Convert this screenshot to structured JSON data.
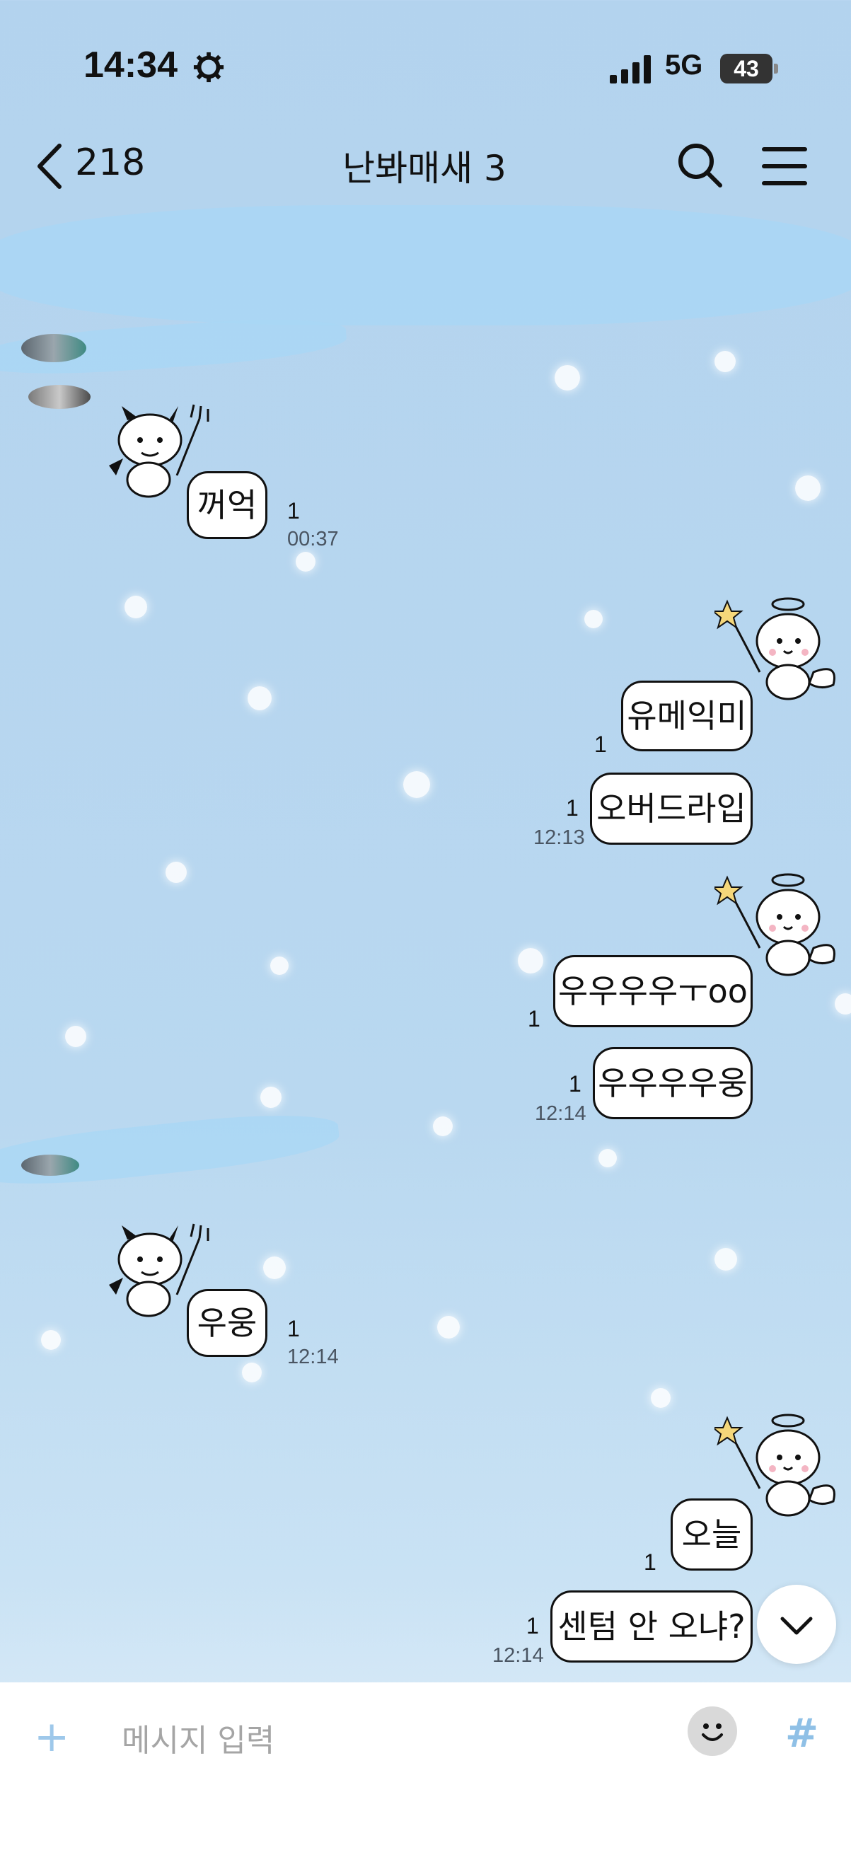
{
  "status_bar": {
    "time": "14:34",
    "network": "5G",
    "battery": "43"
  },
  "header": {
    "back_count": "218",
    "title": "난봐매새 3"
  },
  "messages": [
    {
      "side": "left",
      "text": "꺼억",
      "unread": "1",
      "time": "00:37"
    },
    {
      "side": "right",
      "text": "유메익미",
      "unread": "1",
      "time": ""
    },
    {
      "side": "right",
      "text": "오버드라입",
      "unread": "1",
      "time": "12:13"
    },
    {
      "side": "right",
      "text": "우우우우ㅜoo",
      "unread": "1",
      "time": ""
    },
    {
      "side": "right",
      "text": "우우우우웅",
      "unread": "1",
      "time": "12:14"
    },
    {
      "side": "left",
      "text": "우웅",
      "unread": "1",
      "time": "12:14"
    },
    {
      "side": "right",
      "text": "오늘",
      "unread": "1",
      "time": ""
    },
    {
      "side": "right",
      "text": "센텀 안 오냐?",
      "unread": "1",
      "time": "12:14"
    }
  ],
  "input": {
    "placeholder": "메시지 입력"
  },
  "icons": {
    "back": "chevron-left-icon",
    "search": "search-icon",
    "menu": "menu-icon",
    "plus": "plus-icon",
    "emoji": "emoji-icon",
    "hash": "hashtag-icon",
    "scroll_down": "chevron-down-icon"
  },
  "colors": {
    "background": "#b8d7ef",
    "bubble": "#ffffff",
    "accent": "#8fc0e6"
  }
}
